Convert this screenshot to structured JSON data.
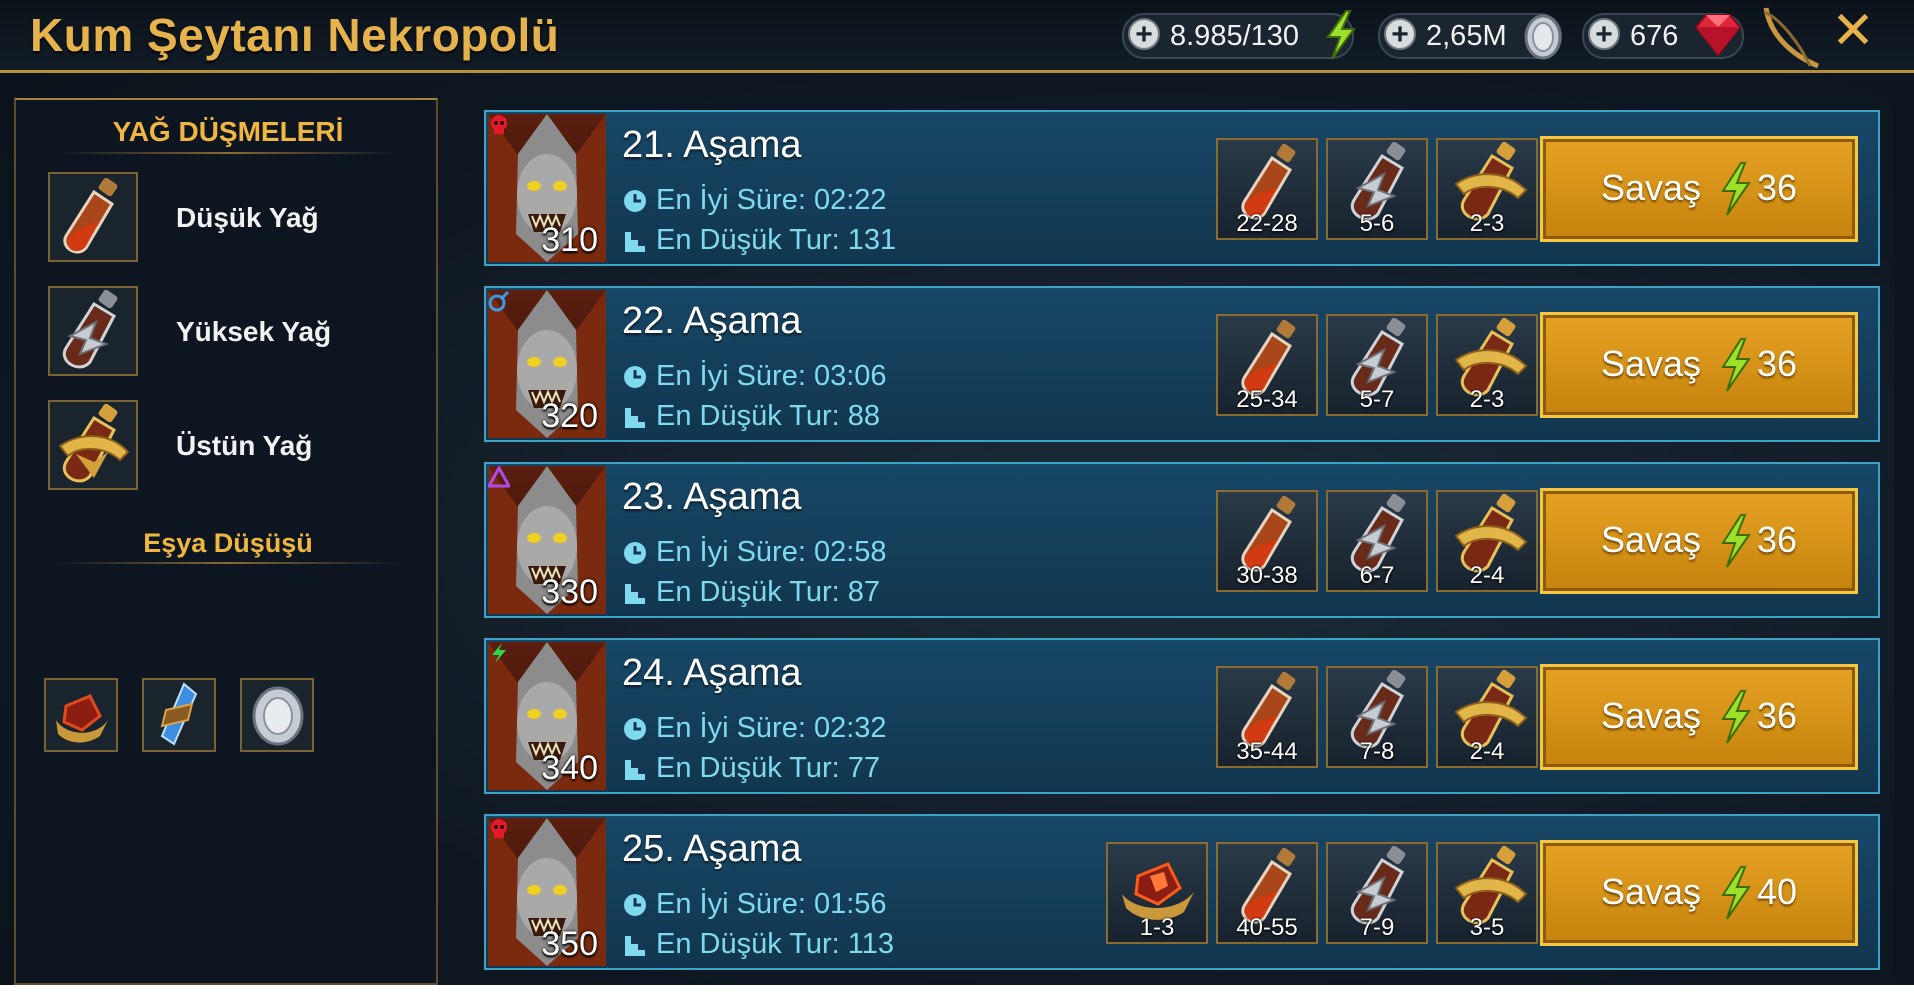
{
  "header": {
    "title": "Kum Şeytanı Nekropolü",
    "energy": "8.985/130",
    "silver": "2,65M",
    "gems": "676"
  },
  "left_panel": {
    "oil_heading": "YAĞ DÜŞMELERİ",
    "oils": [
      {
        "label": "Düşük Yağ",
        "icon": "low-oil-flask-icon"
      },
      {
        "label": "Yüksek Yağ",
        "icon": "high-oil-flask-icon"
      },
      {
        "label": "Üstün Yağ",
        "icon": "superior-oil-flask-icon"
      }
    ],
    "item_heading": "Eşya Düşüşü",
    "items": [
      "artifact-shard-icon",
      "blue-crystal-icon",
      "silver-coin-icon"
    ]
  },
  "stages": [
    {
      "title": "21. Aşama",
      "best_time": "En İyi Süre: 02:22",
      "min_turns": "En Düşük Tur: 131",
      "level": "310",
      "affinity": "skull",
      "rewards": [
        "22-28",
        "5-6",
        "2-3"
      ],
      "artifact": null,
      "fight_label": "Savaş",
      "cost": "36"
    },
    {
      "title": "22. Aşama",
      "best_time": "En İyi Süre: 03:06",
      "min_turns": "En Düşük Tur: 88",
      "level": "320",
      "affinity": "magic",
      "rewards": [
        "25-34",
        "5-7",
        "2-3"
      ],
      "artifact": null,
      "fight_label": "Savaş",
      "cost": "36"
    },
    {
      "title": "23. Aşama",
      "best_time": "En İyi Süre: 02:58",
      "min_turns": "En Düşük Tur: 87",
      "level": "330",
      "affinity": "void",
      "rewards": [
        "30-38",
        "6-7",
        "2-4"
      ],
      "artifact": null,
      "fight_label": "Savaş",
      "cost": "36"
    },
    {
      "title": "24. Aşama",
      "best_time": "En İyi Süre: 02:32",
      "min_turns": "En Düşük Tur: 77",
      "level": "340",
      "affinity": "force",
      "rewards": [
        "35-44",
        "7-8",
        "2-4"
      ],
      "artifact": null,
      "fight_label": "Savaş",
      "cost": "36"
    },
    {
      "title": "25. Aşama",
      "best_time": "En İyi Süre: 01:56",
      "min_turns": "En Düşük Tur: 113",
      "level": "350",
      "affinity": "skull",
      "rewards": [
        "40-55",
        "7-9",
        "3-5"
      ],
      "artifact": "1-3",
      "fight_label": "Savaş",
      "cost": "40"
    }
  ],
  "colors": {
    "gold": "#e5b24c",
    "stat": "#7fd9ef",
    "stage_border": "#3aa3c6",
    "button": "#d9951a"
  }
}
